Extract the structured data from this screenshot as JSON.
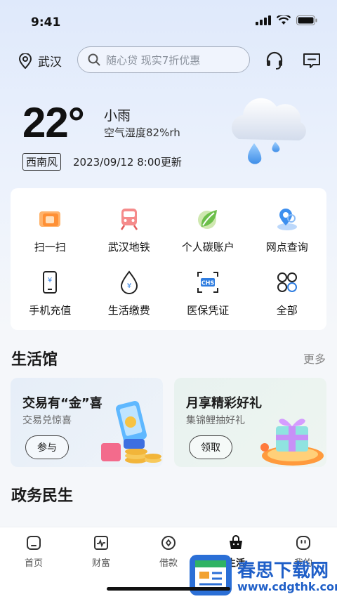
{
  "status": {
    "time": "9:41"
  },
  "topbar": {
    "location": "武汉",
    "search_placeholder": "随心贷 现实7折优惠"
  },
  "weather": {
    "temperature": "22°",
    "condition": "小雨",
    "humidity": "空气湿度82%rh",
    "wind": "西南风",
    "updated": "2023/09/12 8:00更新"
  },
  "services": [
    {
      "label": "扫一扫",
      "icon": "scan-icon"
    },
    {
      "label": "武汉地铁",
      "icon": "metro-icon"
    },
    {
      "label": "个人碳账户",
      "icon": "leaf-icon"
    },
    {
      "label": "网点查询",
      "icon": "location-search-icon"
    },
    {
      "label": "手机充值",
      "icon": "phone-recharge-icon"
    },
    {
      "label": "生活缴费",
      "icon": "water-drop-icon"
    },
    {
      "label": "医保凭证",
      "icon": "medical-insurance-icon"
    },
    {
      "label": "全部",
      "icon": "grid-all-icon"
    }
  ],
  "life_section": {
    "title": "生活馆",
    "more": "更多"
  },
  "promos": [
    {
      "title": "交易有“金”喜",
      "subtitle": "交易兑惊喜",
      "button": "参与"
    },
    {
      "title": "月享精彩好礼",
      "subtitle": "集锦鲤抽好礼",
      "button": "领取"
    }
  ],
  "gov_section": {
    "title": "政务民生"
  },
  "tabs": [
    {
      "label": "首页",
      "icon": "home-icon"
    },
    {
      "label": "财富",
      "icon": "wealth-chart-icon"
    },
    {
      "label": "借款",
      "icon": "loan-icon"
    },
    {
      "label": "生活",
      "icon": "shopping-bag-icon"
    },
    {
      "label": "我的",
      "icon": "profile-icon"
    }
  ],
  "watermark": {
    "text": "春思下载网",
    "url": "www.cdgthk.com"
  },
  "colors": {
    "accent": "#1f6fe0",
    "text": "#1a1a1a",
    "muted": "#888888"
  }
}
